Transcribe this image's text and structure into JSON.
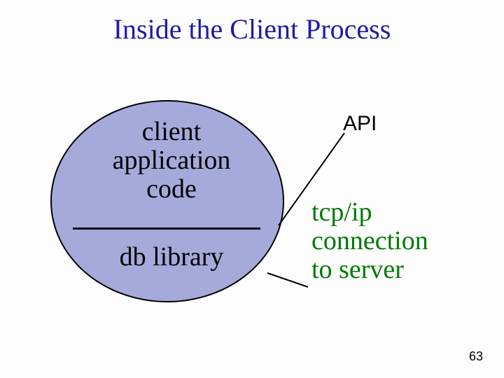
{
  "title": "Inside the Client Process",
  "ellipse": {
    "top_label": "client\napplication\ncode",
    "bottom_label": "db library"
  },
  "annotations": {
    "api": "API",
    "tcpip": "tcp/ip\nconnection\nto server"
  },
  "page_number": "63"
}
